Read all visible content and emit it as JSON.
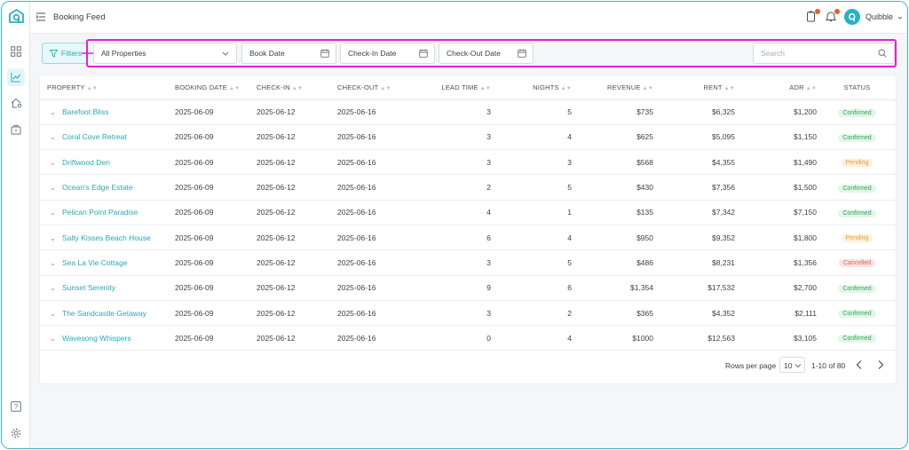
{
  "app": {
    "brand": "Quibble"
  },
  "header": {
    "title": "Booking Feed",
    "user_name": "Quibble"
  },
  "filterbar": {
    "filters_label": "Filters",
    "property_select": "All Properties",
    "book_date": "Book Date",
    "check_in_date": "Check-In Date",
    "check_out_date": "Check-Out Date",
    "search_placeholder": "Search"
  },
  "table": {
    "columns": [
      "PROPERTY",
      "BOOKING DATE",
      "CHECK-IN",
      "CHECK-OUT",
      "LEAD TIME",
      "NIGHTS",
      "REVENUE",
      "RENT",
      "ADR",
      "STATUS"
    ],
    "rows": [
      {
        "property": "Barefoot Bliss",
        "booking_date": "2025-06-09",
        "check_in": "2025-06-12",
        "check_out": "2025-06-16",
        "lead_time": "3",
        "nights": "5",
        "revenue": "$735",
        "rent": "$6,325",
        "adr": "$1,200",
        "status": "Confirmed"
      },
      {
        "property": "Coral Cove Retreat",
        "booking_date": "2025-06-09",
        "check_in": "2025-06-12",
        "check_out": "2025-06-16",
        "lead_time": "3",
        "nights": "4",
        "revenue": "$625",
        "rent": "$5,095",
        "adr": "$1,150",
        "status": "Confirmed"
      },
      {
        "property": "Driftwood Den",
        "booking_date": "2025-06-09",
        "check_in": "2025-06-12",
        "check_out": "2025-06-16",
        "lead_time": "3",
        "nights": "3",
        "revenue": "$568",
        "rent": "$4,355",
        "adr": "$1,490",
        "status": "Pending"
      },
      {
        "property": "Ocean's Edge Estate",
        "booking_date": "2025-06-09",
        "check_in": "2025-06-12",
        "check_out": "2025-06-16",
        "lead_time": "2",
        "nights": "5",
        "revenue": "$430",
        "rent": "$7,356",
        "adr": "$1,500",
        "status": "Confirmed"
      },
      {
        "property": "Pelican Point Paradise",
        "booking_date": "2025-06-09",
        "check_in": "2025-06-12",
        "check_out": "2025-06-16",
        "lead_time": "4",
        "nights": "1",
        "revenue": "$135",
        "rent": "$7,342",
        "adr": "$7,150",
        "status": "Confirmed"
      },
      {
        "property": "Salty Kisses Beach House",
        "booking_date": "2025-06-09",
        "check_in": "2025-06-12",
        "check_out": "2025-06-16",
        "lead_time": "6",
        "nights": "4",
        "revenue": "$950",
        "rent": "$9,352",
        "adr": "$1,800",
        "status": "Pending"
      },
      {
        "property": "Sea La Vie Cottage",
        "booking_date": "2025-06-09",
        "check_in": "2025-06-12",
        "check_out": "2025-06-16",
        "lead_time": "3",
        "nights": "5",
        "revenue": "$486",
        "rent": "$8,231",
        "adr": "$1,356",
        "status": "Cancelled"
      },
      {
        "property": "Sunset Serenity",
        "booking_date": "2025-06-09",
        "check_in": "2025-06-12",
        "check_out": "2025-06-16",
        "lead_time": "9",
        "nights": "6",
        "revenue": "$1,354",
        "rent": "$17,532",
        "adr": "$2,700",
        "status": "Confirmed"
      },
      {
        "property": "The Sandcastle Getaway",
        "booking_date": "2025-06-09",
        "check_in": "2025-06-12",
        "check_out": "2025-06-16",
        "lead_time": "3",
        "nights": "2",
        "revenue": "$365",
        "rent": "$4,352",
        "adr": "$2,111",
        "status": "Confirmed"
      },
      {
        "property": "Wavesong Whispers",
        "booking_date": "2025-06-09",
        "check_in": "2025-06-12",
        "check_out": "2025-06-16",
        "lead_time": "0",
        "nights": "4",
        "revenue": "$1000",
        "rent": "$12,563",
        "adr": "$3,105",
        "status": "Confirmed"
      }
    ]
  },
  "pagination": {
    "rows_per_page_label": "Rows per page",
    "rows_per_page": "10",
    "range": "1-10 of 80"
  },
  "colors": {
    "accent": "#27b3bf",
    "highlight": "#e51fd2",
    "confirmed": "#33a35a",
    "pending": "#e3a23a",
    "cancelled": "#e25f5f",
    "badge": "#e85d2c"
  },
  "icons": {
    "sidebar": [
      "logo-icon",
      "dashboard-icon",
      "chart-icon",
      "home-settings-icon",
      "briefcase-icon",
      "help-icon",
      "gear-icon"
    ],
    "topbar": [
      "menu-collapse-icon",
      "clipboard-icon",
      "bell-icon"
    ]
  }
}
